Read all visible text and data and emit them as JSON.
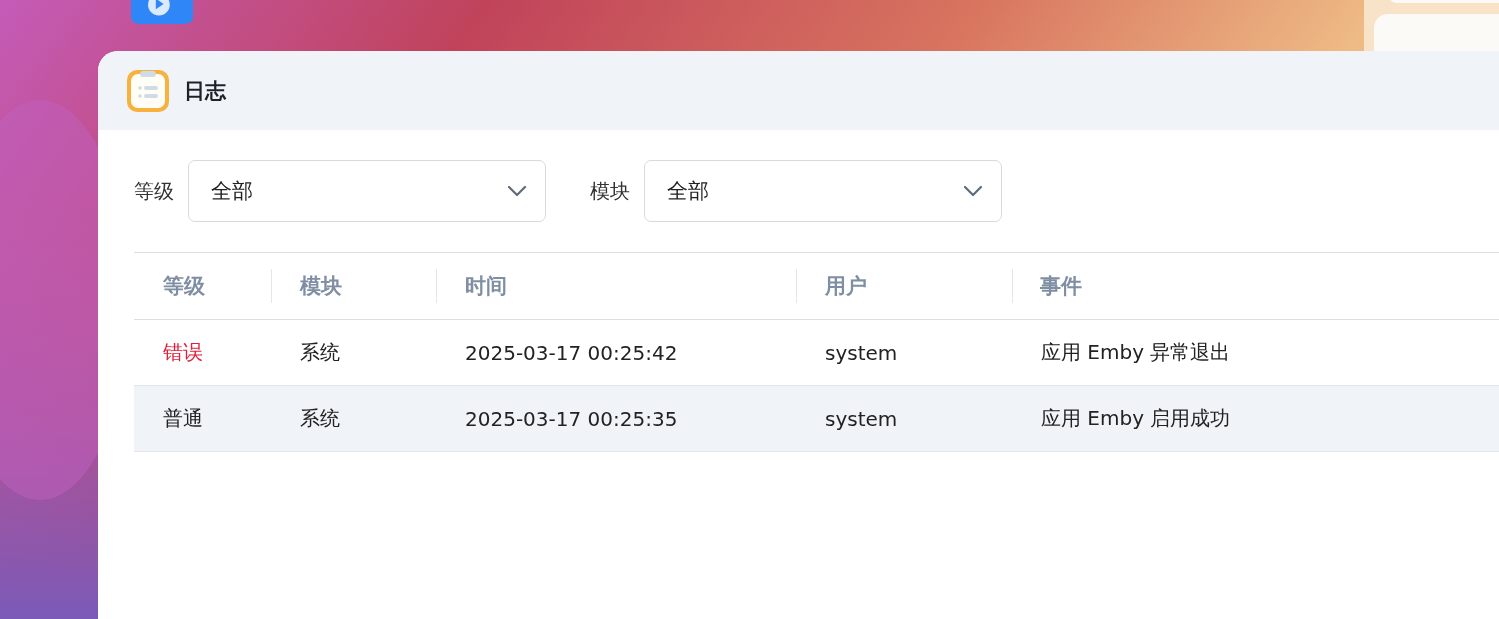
{
  "window": {
    "title": "日志"
  },
  "filters": [
    {
      "label": "等级",
      "value": "全部"
    },
    {
      "label": "模块",
      "value": "全部"
    }
  ],
  "table": {
    "columns": [
      "等级",
      "模块",
      "时间",
      "用户",
      "事件"
    ],
    "rows": [
      {
        "kind": "error",
        "selected": false,
        "cells": [
          "错误",
          "系统",
          "2025-03-17 00:25:42",
          "system",
          "应用 Emby 异常退出"
        ]
      },
      {
        "kind": "normal",
        "selected": true,
        "cells": [
          "普通",
          "系统",
          "2025-03-17 00:25:35",
          "system",
          "应用 Emby 启用成功"
        ]
      }
    ]
  }
}
